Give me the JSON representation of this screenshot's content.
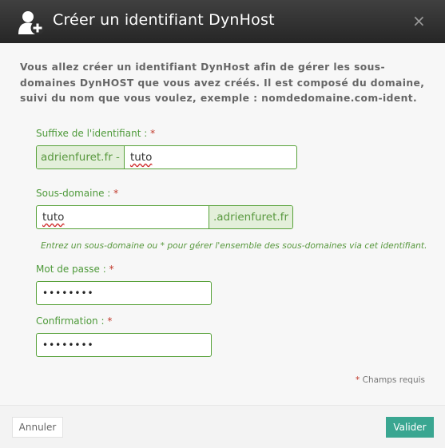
{
  "dialog": {
    "title": "Créer un identifiant DynHost",
    "close": "×",
    "icon": "add-user-icon"
  },
  "intro": "Vous allez créer un identifiant DynHost afin de gérer les sous-domaines DynHOST que vous avez créés. Il est composé du domaine, suivi du nom que vous voulez, exemple : nomdedomaine.com-ident.",
  "form": {
    "suffix": {
      "label": "Suffixe de l'identifiant :",
      "required_mark": "*",
      "prefix": "adrienfuret.fr -",
      "value": "tuto"
    },
    "subdomain": {
      "label": "Sous-domaine :",
      "required_mark": "*",
      "value": "tuto",
      "suffix": ".adrienfuret.fr",
      "hint": "Entrez un sous-domaine ou * pour gérer l'ensemble des sous-domaines via cet identifiant."
    },
    "password": {
      "label": "Mot de passe :",
      "required_mark": "*",
      "value": "••••••••"
    },
    "confirmation": {
      "label": "Confirmation :",
      "required_mark": "*",
      "value": "••••••••"
    },
    "required_note": {
      "mark": "*",
      "text": "Champs requis"
    }
  },
  "footer": {
    "cancel_label": "Annuler",
    "validate_label": "Valider"
  },
  "colors": {
    "header": "#303030",
    "accent_green": "#58a23a",
    "addon_bg": "#e3efda",
    "validate_button": "#3aa691",
    "required": "#c0392b"
  }
}
